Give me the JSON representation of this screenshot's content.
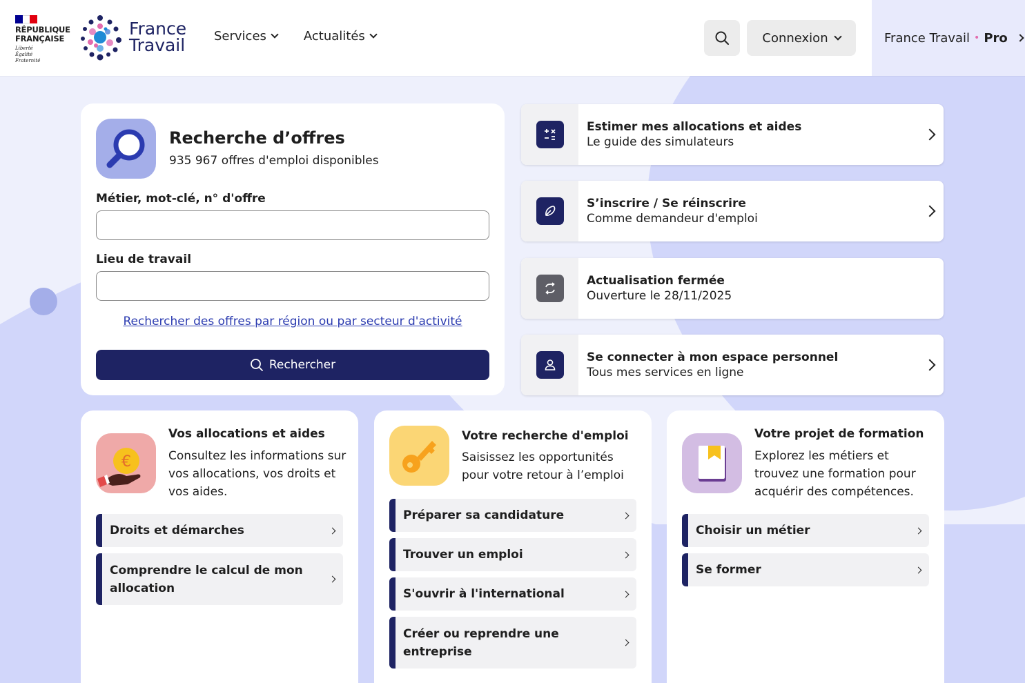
{
  "header": {
    "gov_flag_colors": [
      "#000091",
      "#ffffff",
      "#e1000f"
    ],
    "gov_name_line1": "RÉPUBLIQUE",
    "gov_name_line2": "FRANÇAISE",
    "gov_motto": [
      "Liberté",
      "Égalité",
      "Fraternité"
    ],
    "brand_line1": "France",
    "brand_line2": "Travail",
    "nav": [
      {
        "label": "Services"
      },
      {
        "label": "Actualités"
      }
    ],
    "search_icon": "search-icon",
    "connexion_label": "Connexion",
    "pro_label_prefix": "France Travail",
    "pro_label_dot": "•",
    "pro_label_suffix": "Pro"
  },
  "search_card": {
    "title": "Recherche d’offres",
    "subtitle": "935 967 offres d'emploi disponibles",
    "job_label": "Métier, mot-clé, n° d'offre",
    "job_value": "",
    "location_label": "Lieu de travail",
    "location_value": "",
    "region_link": "Rechercher des offres par région ou par secteur d'activité",
    "submit_label": "Rechercher"
  },
  "tiles": [
    {
      "title": "Estimer mes allocations et aides",
      "subtitle": "Le guide des simulateurs",
      "icon": "calculator-icon",
      "has_chevron": true
    },
    {
      "title": "S’inscrire / Se réinscrire",
      "subtitle": "Comme demandeur d'emploi",
      "icon": "pen-icon",
      "has_chevron": true
    },
    {
      "title": "Actualisation fermée",
      "subtitle": "Ouverture le 28/11/2025",
      "icon": "refresh-icon",
      "has_chevron": false
    },
    {
      "title": "Se connecter à mon espace personnel",
      "subtitle": "Tous mes services en ligne",
      "icon": "user-icon",
      "has_chevron": true
    }
  ],
  "cards": [
    {
      "title": "Vos allocations et aides",
      "description": "Consultez les informations sur vos allocations, vos droits et vos aides.",
      "icon": "euro-coin-hand-icon",
      "links": [
        "Droits et démarches",
        "Comprendre le calcul de mon allocation"
      ]
    },
    {
      "title": "Votre recherche d'emploi",
      "description": "Saisissez les opportunités pour votre retour à l’emploi",
      "icon": "key-icon",
      "links": [
        "Préparer sa candidature",
        "Trouver un emploi",
        "S'ouvrir à l'international",
        "Créer ou reprendre une entreprise"
      ]
    },
    {
      "title": "Votre projet de formation",
      "description": "Explorez les métiers et trouvez une formation pour acquérir des compétences.",
      "icon": "book-icon",
      "links": [
        "Choisir un métier",
        "Se former"
      ]
    }
  ],
  "colors": {
    "primary": "#1e2363",
    "background": "#eef0fc",
    "wave": "#d1d6fa",
    "link": "#2b3bb0"
  }
}
